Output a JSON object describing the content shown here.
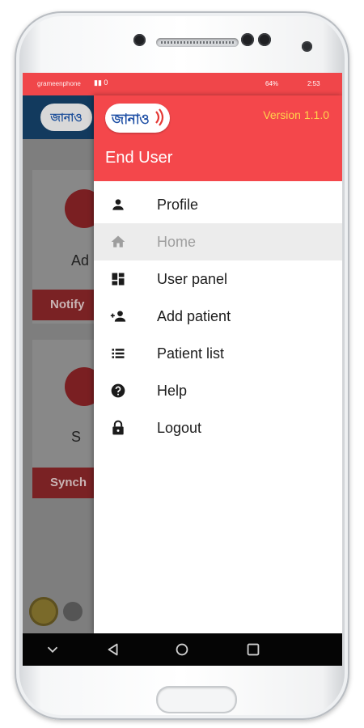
{
  "status_bar": {
    "carrier": "grameenphone",
    "signal": "▮▮ 0",
    "battery": "64%",
    "time": "2:53"
  },
  "background_app": {
    "logo_text": "জানাও",
    "card1_label": "Ad",
    "card1_button": "Notify",
    "card2_label": "S",
    "card2_button": "Synch"
  },
  "drawer": {
    "logo_text": "জানাও",
    "version": "Version 1.1.0",
    "user_role": "End User",
    "items": [
      {
        "label": "Profile",
        "icon": "person-icon",
        "active": false
      },
      {
        "label": "Home",
        "icon": "home-icon",
        "active": true
      },
      {
        "label": "User panel",
        "icon": "dashboard-icon",
        "active": false
      },
      {
        "label": "Add patient",
        "icon": "person-add-icon",
        "active": false
      },
      {
        "label": "Patient list",
        "icon": "list-icon",
        "active": false
      },
      {
        "label": "Help",
        "icon": "help-icon",
        "active": false
      },
      {
        "label": "Logout",
        "icon": "lock-icon",
        "active": false
      }
    ]
  },
  "colors": {
    "accent": "#f4474b",
    "version_text": "#ffd34d",
    "logo_blue": "#1e4fa5"
  },
  "navbar": {
    "buttons": [
      "chevron-down-icon",
      "back-icon",
      "home-circle-icon",
      "recents-icon"
    ]
  }
}
